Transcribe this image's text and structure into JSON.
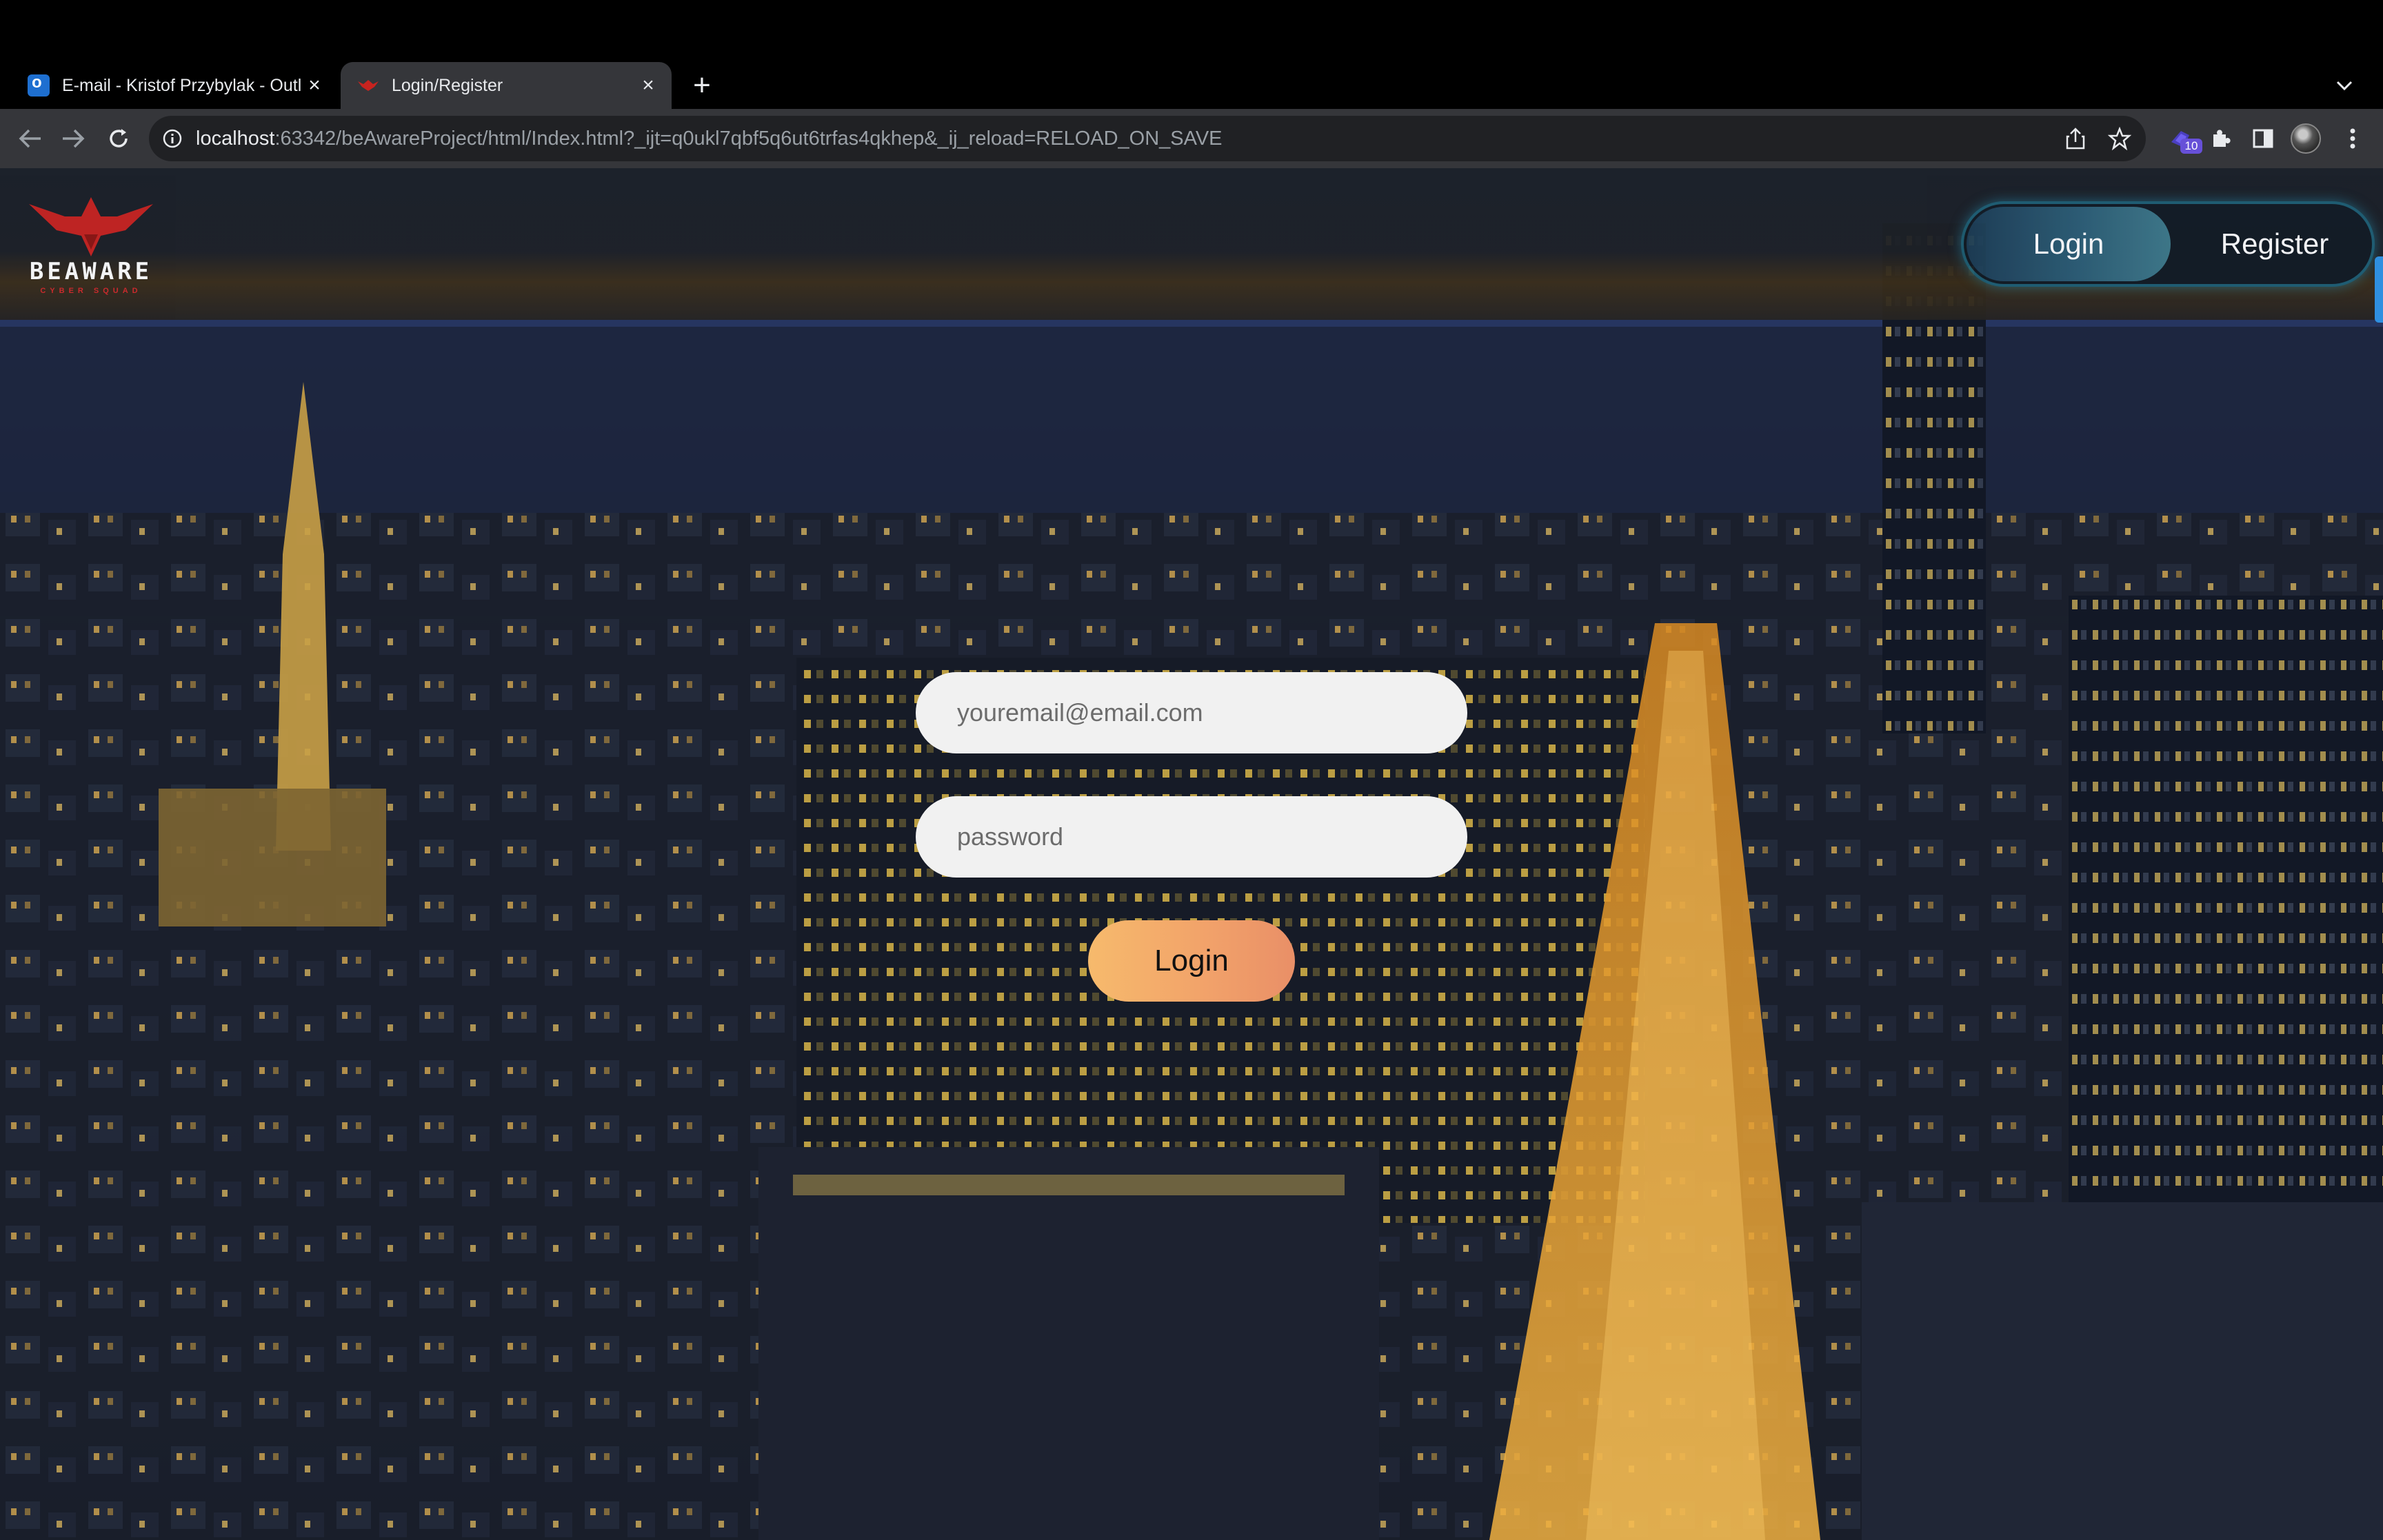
{
  "browser": {
    "tabs": [
      {
        "title": "E-mail - Kristof Przybylak - Outlook",
        "icon": "outlook-icon",
        "active": false
      },
      {
        "title": "Login/Register",
        "icon": "beaware-favicon",
        "active": true
      }
    ],
    "address_bar": {
      "host": "localhost",
      "rest": ":63342/beAwareProject/html/Index.html?_ijt=q0ukl7qbf5q6ut6trfas4qkhep&_ij_reload=RELOAD_ON_SAVE"
    },
    "extension_badge": "10"
  },
  "header": {
    "logo_text": "BEAWARE",
    "logo_subtext": "CYBER SQUAD",
    "toggle": {
      "login_label": "Login",
      "register_label": "Register",
      "selected": "Login"
    }
  },
  "form": {
    "email_placeholder": "youremail@email.com",
    "password_placeholder": "password",
    "submit_label": "Login"
  },
  "colors": {
    "chrome_bg": "#000000",
    "toolbar_bg": "#35363a",
    "login_button": "#f2a36a",
    "toggle_border": "#1f5f73",
    "logo_red": "#c8231f"
  }
}
